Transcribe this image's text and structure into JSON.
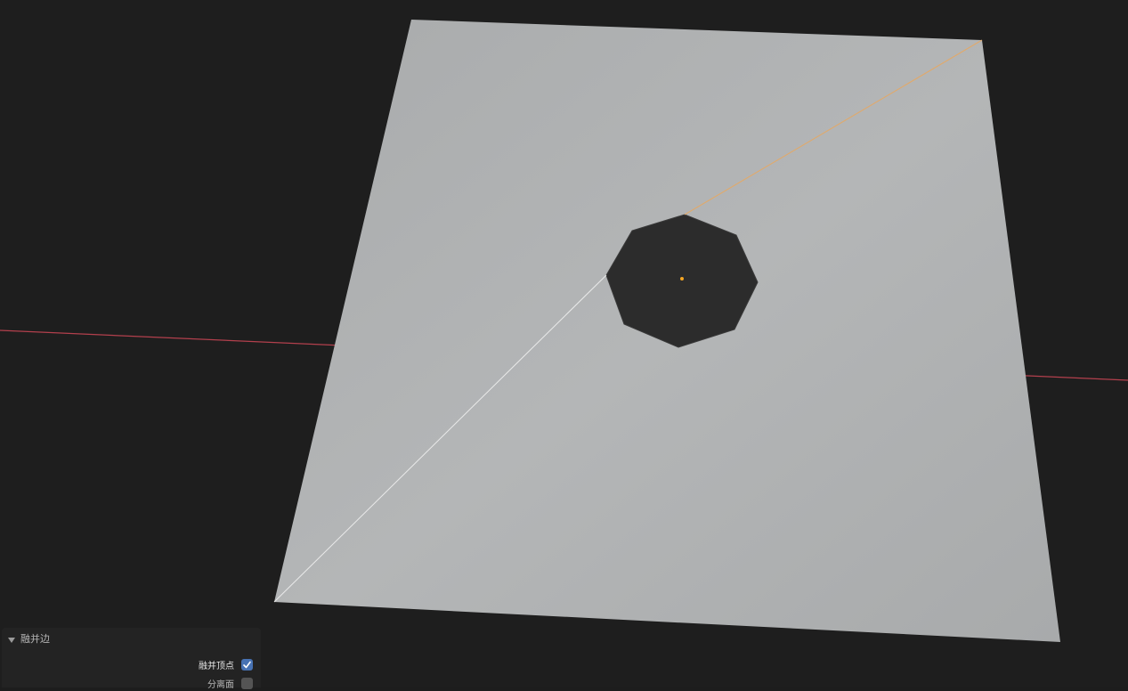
{
  "scene": {
    "background": "#1e1e1e",
    "plane_color": "#b2b4b5",
    "hole_color": "#2c2c2c",
    "x_axis_color": "#b3404d",
    "selected_edge_color": "#e8a860",
    "highlight_edge_color": "#e6e6e6",
    "origin_color": "#f5a623"
  },
  "operator_panel": {
    "title": "融并边",
    "collapse_icon": "triangle-down-icon",
    "options": [
      {
        "label": "融并顶点",
        "checked": true
      },
      {
        "label": "分离面",
        "checked": false
      }
    ],
    "accent_color": "#4772b3"
  }
}
